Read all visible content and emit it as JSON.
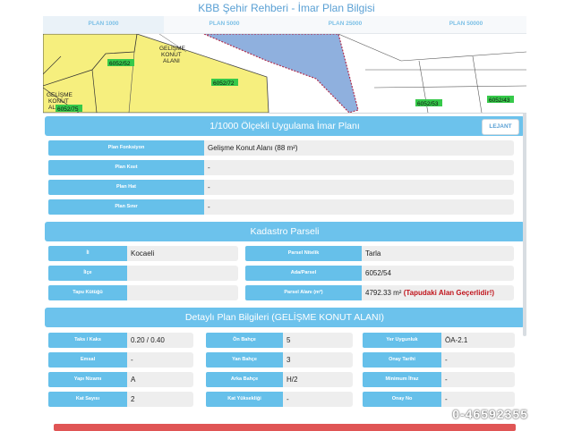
{
  "header": {
    "title": "KBB Şehir Rehberi - İmar Plan Bilgisi"
  },
  "tabs": [
    {
      "label": "PLAN 1000"
    },
    {
      "label": "PLAN 5000"
    },
    {
      "label": "PLAN 25000"
    },
    {
      "label": "PLAN 50000"
    }
  ],
  "map": {
    "labels": [
      "GELİŞME KONUT ALANI",
      "6052/52",
      "6052/72",
      "GELİŞME KONUT ALANI",
      "6052/75",
      "6052/53",
      "6052/43"
    ]
  },
  "plan": {
    "title": "1/1000 Ölçekli Uygulama İmar Planı",
    "legend_label": "LEJANT",
    "rows": [
      {
        "label": "Plan Fonksiyon",
        "value": "Gelişme Konut Alanı (88 m²)"
      },
      {
        "label": "Plan Kısıt",
        "value": "-"
      },
      {
        "label": "Plan Hat",
        "value": "-"
      },
      {
        "label": "Plan Sınır",
        "value": "-"
      }
    ]
  },
  "kadastro": {
    "title": "Kadastro Parseli",
    "left": [
      {
        "label": "İl",
        "value": "Kocaeli"
      },
      {
        "label": "İlçe",
        "value": ""
      },
      {
        "label": "Tapu Kütüğü",
        "value": ""
      }
    ],
    "right": [
      {
        "label": "Parsel Nitelik",
        "value": "Tarla"
      },
      {
        "label": "Ada/Parsel",
        "value": "6052/54"
      },
      {
        "label": "Parsel Alanı (m²)",
        "value": "4792.33 m²",
        "note": "(Tapudaki Alan Geçerlidir!)"
      }
    ]
  },
  "detay": {
    "title": "Detaylı Plan Bilgileri (GELİŞME KONUT ALANI)",
    "col1": [
      {
        "label": "Taks / Kaks",
        "value": "0.20 / 0.40"
      },
      {
        "label": "Emsal",
        "value": "-"
      },
      {
        "label": "Yapı Nizamı",
        "value": "A"
      },
      {
        "label": "Kat Sayısı",
        "value": "2"
      }
    ],
    "col2": [
      {
        "label": "Ön Bahçe",
        "value": "5"
      },
      {
        "label": "Yan Bahçe",
        "value": "3"
      },
      {
        "label": "Arka Bahçe",
        "value": "H/2"
      },
      {
        "label": "Kat Yüksekliği",
        "value": "-"
      }
    ],
    "col3": [
      {
        "label": "Yer Uygunluk",
        "value": "ÖA-2.1"
      },
      {
        "label": "Onay Tarihi",
        "value": "-"
      },
      {
        "label": "Minimum İfraz",
        "value": "-"
      },
      {
        "label": "Onay No",
        "value": "-"
      }
    ]
  },
  "watermark": "0-46592355",
  "colors": {
    "accent": "#6cc2ec",
    "map_yellow": "#f6ef7e",
    "map_blue": "#8fb0de",
    "parcel_green": "#36c94a"
  }
}
